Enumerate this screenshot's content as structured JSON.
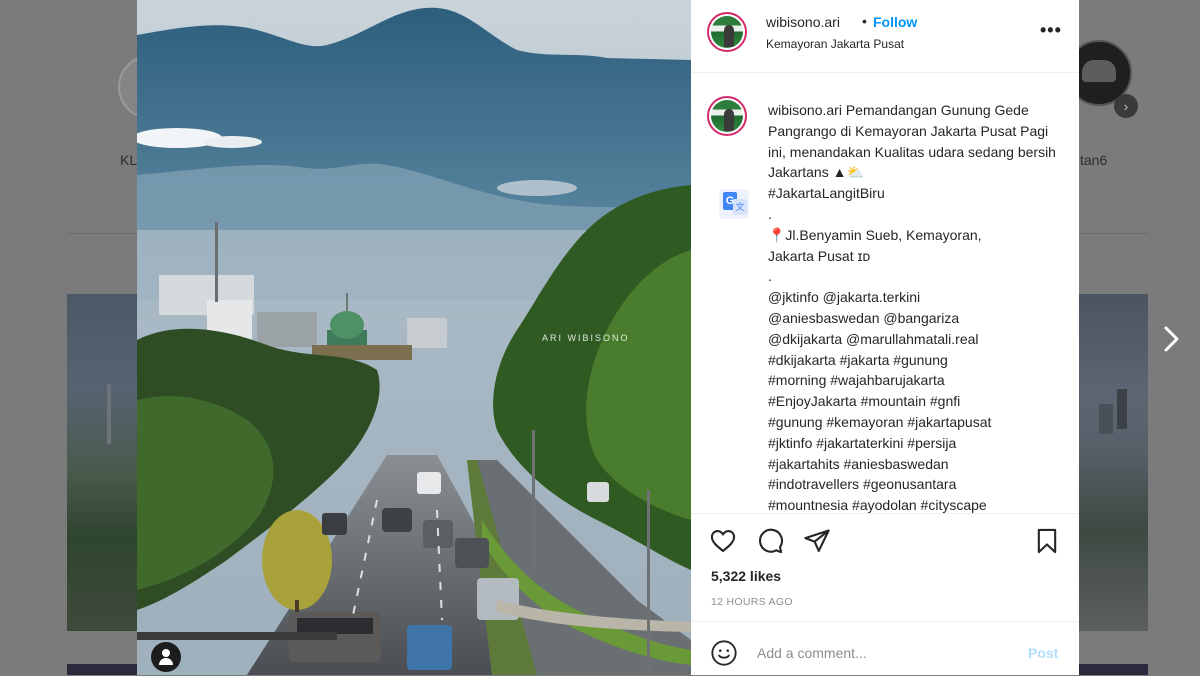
{
  "background": {
    "story_left_label": "KL",
    "story_right_label": "tan6"
  },
  "photo": {
    "watermark": "ARI WIBISONO"
  },
  "header": {
    "username": "wibisono.ari",
    "separator": "•",
    "follow_label": "Follow",
    "location": "Kemayoran Jakarta Pusat",
    "more_label": "•••"
  },
  "caption": {
    "username": "wibisono.ari",
    "lines": [
      "Pemandangan Gunung Gede Pangrango di Kemayoran Jakarta Pusat Pagi ini, menandakan Kualitas udara sedang bersih Jakartans ▲⛅",
      "#JakartaLangitBiru",
      ".",
      "📍Jl.Benyamin Sueb, Kemayoran,",
      "Jakarta Pusat ɪᴅ",
      ".",
      "@jktinfo @jakarta.terkini",
      "@aniesbaswedan @bangariza",
      "@dkijakarta @marullahmatali.real",
      "#dkijakarta #jakarta #gunung",
      "#morning #wajahbarujakarta",
      "#EnjoyJakarta #mountain #gnfi",
      "#gunung #kemayoran #jakartapusat",
      "#jktinfo #jakartaterkini #persija",
      "#jakartahits #aniesbaswedan",
      "#indotravellers #geonusantara",
      "#mountnesia #ayodolan #cityscape"
    ]
  },
  "actions": {
    "likes": "5,322 likes",
    "timestamp": "12 HOURS AGO"
  },
  "comment": {
    "placeholder": "Add a comment...",
    "post_label": "Post"
  },
  "icons": {
    "like": "heart-icon",
    "comment": "comment-bubble-icon",
    "share": "paper-plane-icon",
    "save": "bookmark-icon",
    "emoji": "smiley-icon",
    "translate": "google-translate-icon",
    "next": "chevron-right-icon",
    "tag": "user-tag-icon"
  },
  "colors": {
    "follow": "#0095f6",
    "post_disabled": "#b2dffc",
    "text": "#262626",
    "muted": "#8e8e8e",
    "overlay": "#7b7b7b"
  }
}
